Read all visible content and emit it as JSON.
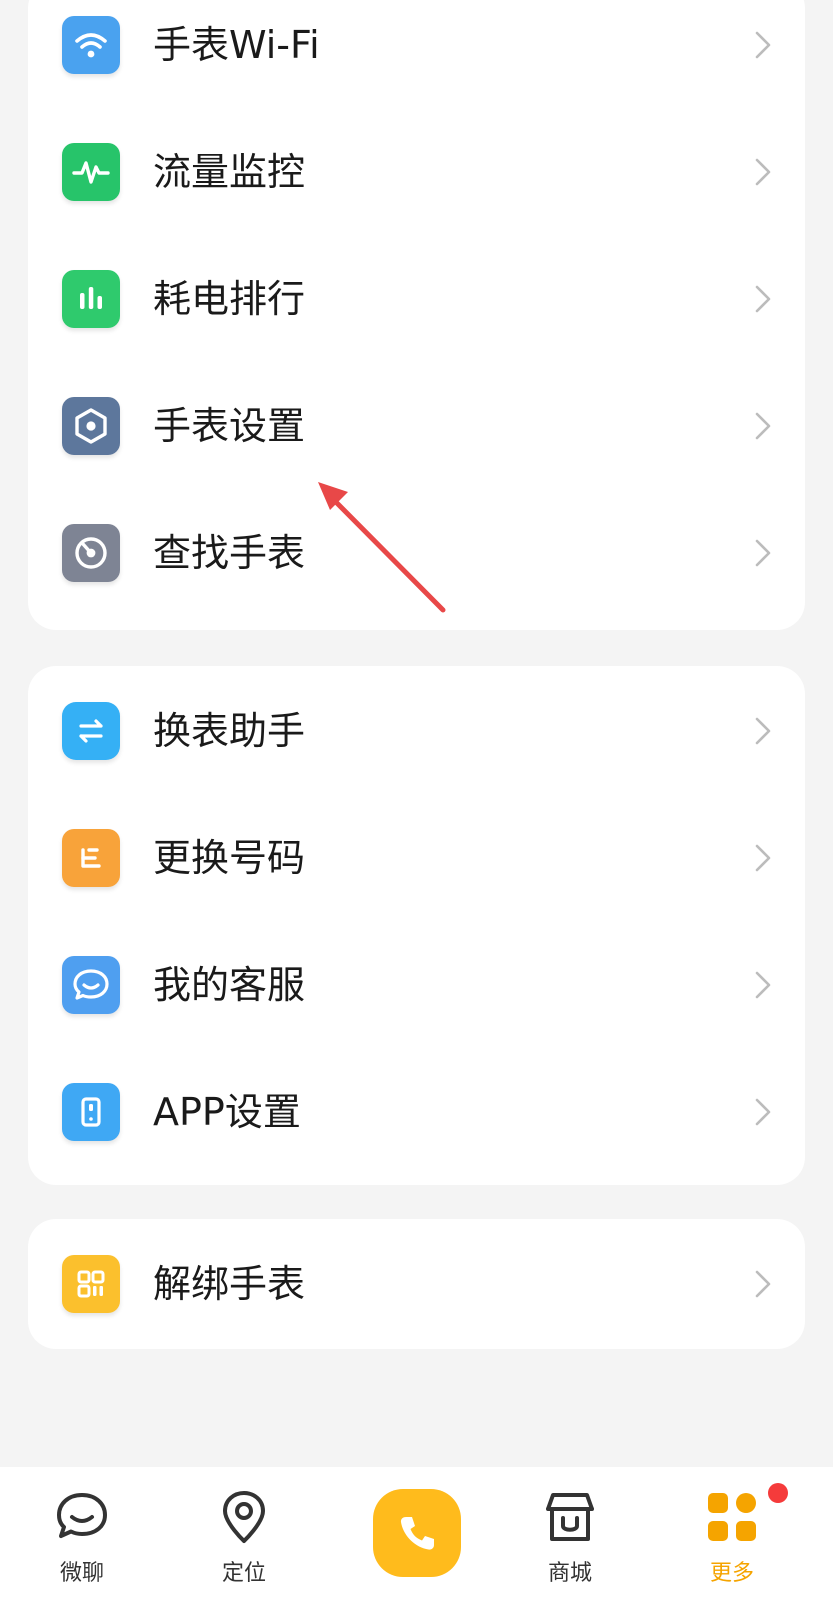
{
  "colors": {
    "accent": "#ffbb1c",
    "active_tab": "#f5a400",
    "badge": "#f53b3b",
    "wifi": "#4aa2ef",
    "traffic": "#27c46a",
    "battery": "#2fca6d",
    "settings": "#5d779c",
    "find": "#7e8494",
    "switch": "#35b0f5",
    "number": "#f8a33a",
    "service": "#4f9ff0",
    "app": "#3fa8f4",
    "unbind": "#fbc02d"
  },
  "group1": {
    "items": [
      {
        "label": "手表Wi-Fi",
        "icon": "wifi-icon"
      },
      {
        "label": "流量监控",
        "icon": "pulse-icon"
      },
      {
        "label": "耗电排行",
        "icon": "bar-chart-icon"
      },
      {
        "label": "手表设置",
        "icon": "hexagon-settings-icon"
      },
      {
        "label": "查找手表",
        "icon": "find-watch-icon"
      }
    ]
  },
  "group2": {
    "items": [
      {
        "label": "换表助手",
        "icon": "swap-icon"
      },
      {
        "label": "更换号码",
        "icon": "sim-card-icon"
      },
      {
        "label": "我的客服",
        "icon": "chat-smile-icon"
      },
      {
        "label": "APP设置",
        "icon": "phone-device-icon"
      }
    ]
  },
  "group3": {
    "items": [
      {
        "label": "解绑手表",
        "icon": "qr-code-icon"
      }
    ]
  },
  "tabbar": {
    "tabs": [
      {
        "label": "微聊",
        "icon": "chat-bubble-icon"
      },
      {
        "label": "定位",
        "icon": "location-pin-icon"
      },
      {
        "label": "",
        "icon": "phone-icon"
      },
      {
        "label": "商城",
        "icon": "store-icon"
      },
      {
        "label": "更多",
        "icon": "grid-more-icon",
        "active": true
      }
    ]
  }
}
